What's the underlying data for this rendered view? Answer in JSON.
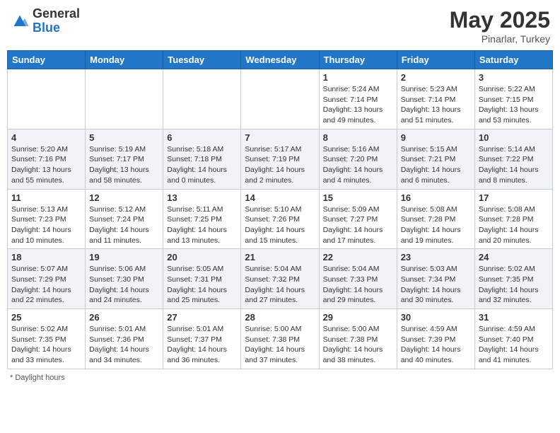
{
  "header": {
    "logo_general": "General",
    "logo_blue": "Blue",
    "month": "May 2025",
    "location": "Pinarlar, Turkey"
  },
  "days_of_week": [
    "Sunday",
    "Monday",
    "Tuesday",
    "Wednesday",
    "Thursday",
    "Friday",
    "Saturday"
  ],
  "footer": {
    "daylight_label": "Daylight hours"
  },
  "weeks": [
    {
      "days": [
        {
          "num": "",
          "info": ""
        },
        {
          "num": "",
          "info": ""
        },
        {
          "num": "",
          "info": ""
        },
        {
          "num": "",
          "info": ""
        },
        {
          "num": "1",
          "info": "Sunrise: 5:24 AM\nSunset: 7:14 PM\nDaylight: 13 hours\nand 49 minutes."
        },
        {
          "num": "2",
          "info": "Sunrise: 5:23 AM\nSunset: 7:14 PM\nDaylight: 13 hours\nand 51 minutes."
        },
        {
          "num": "3",
          "info": "Sunrise: 5:22 AM\nSunset: 7:15 PM\nDaylight: 13 hours\nand 53 minutes."
        }
      ]
    },
    {
      "days": [
        {
          "num": "4",
          "info": "Sunrise: 5:20 AM\nSunset: 7:16 PM\nDaylight: 13 hours\nand 55 minutes."
        },
        {
          "num": "5",
          "info": "Sunrise: 5:19 AM\nSunset: 7:17 PM\nDaylight: 13 hours\nand 58 minutes."
        },
        {
          "num": "6",
          "info": "Sunrise: 5:18 AM\nSunset: 7:18 PM\nDaylight: 14 hours\nand 0 minutes."
        },
        {
          "num": "7",
          "info": "Sunrise: 5:17 AM\nSunset: 7:19 PM\nDaylight: 14 hours\nand 2 minutes."
        },
        {
          "num": "8",
          "info": "Sunrise: 5:16 AM\nSunset: 7:20 PM\nDaylight: 14 hours\nand 4 minutes."
        },
        {
          "num": "9",
          "info": "Sunrise: 5:15 AM\nSunset: 7:21 PM\nDaylight: 14 hours\nand 6 minutes."
        },
        {
          "num": "10",
          "info": "Sunrise: 5:14 AM\nSunset: 7:22 PM\nDaylight: 14 hours\nand 8 minutes."
        }
      ]
    },
    {
      "days": [
        {
          "num": "11",
          "info": "Sunrise: 5:13 AM\nSunset: 7:23 PM\nDaylight: 14 hours\nand 10 minutes."
        },
        {
          "num": "12",
          "info": "Sunrise: 5:12 AM\nSunset: 7:24 PM\nDaylight: 14 hours\nand 11 minutes."
        },
        {
          "num": "13",
          "info": "Sunrise: 5:11 AM\nSunset: 7:25 PM\nDaylight: 14 hours\nand 13 minutes."
        },
        {
          "num": "14",
          "info": "Sunrise: 5:10 AM\nSunset: 7:26 PM\nDaylight: 14 hours\nand 15 minutes."
        },
        {
          "num": "15",
          "info": "Sunrise: 5:09 AM\nSunset: 7:27 PM\nDaylight: 14 hours\nand 17 minutes."
        },
        {
          "num": "16",
          "info": "Sunrise: 5:08 AM\nSunset: 7:28 PM\nDaylight: 14 hours\nand 19 minutes."
        },
        {
          "num": "17",
          "info": "Sunrise: 5:08 AM\nSunset: 7:28 PM\nDaylight: 14 hours\nand 20 minutes."
        }
      ]
    },
    {
      "days": [
        {
          "num": "18",
          "info": "Sunrise: 5:07 AM\nSunset: 7:29 PM\nDaylight: 14 hours\nand 22 minutes."
        },
        {
          "num": "19",
          "info": "Sunrise: 5:06 AM\nSunset: 7:30 PM\nDaylight: 14 hours\nand 24 minutes."
        },
        {
          "num": "20",
          "info": "Sunrise: 5:05 AM\nSunset: 7:31 PM\nDaylight: 14 hours\nand 25 minutes."
        },
        {
          "num": "21",
          "info": "Sunrise: 5:04 AM\nSunset: 7:32 PM\nDaylight: 14 hours\nand 27 minutes."
        },
        {
          "num": "22",
          "info": "Sunrise: 5:04 AM\nSunset: 7:33 PM\nDaylight: 14 hours\nand 29 minutes."
        },
        {
          "num": "23",
          "info": "Sunrise: 5:03 AM\nSunset: 7:34 PM\nDaylight: 14 hours\nand 30 minutes."
        },
        {
          "num": "24",
          "info": "Sunrise: 5:02 AM\nSunset: 7:35 PM\nDaylight: 14 hours\nand 32 minutes."
        }
      ]
    },
    {
      "days": [
        {
          "num": "25",
          "info": "Sunrise: 5:02 AM\nSunset: 7:35 PM\nDaylight: 14 hours\nand 33 minutes."
        },
        {
          "num": "26",
          "info": "Sunrise: 5:01 AM\nSunset: 7:36 PM\nDaylight: 14 hours\nand 34 minutes."
        },
        {
          "num": "27",
          "info": "Sunrise: 5:01 AM\nSunset: 7:37 PM\nDaylight: 14 hours\nand 36 minutes."
        },
        {
          "num": "28",
          "info": "Sunrise: 5:00 AM\nSunset: 7:38 PM\nDaylight: 14 hours\nand 37 minutes."
        },
        {
          "num": "29",
          "info": "Sunrise: 5:00 AM\nSunset: 7:38 PM\nDaylight: 14 hours\nand 38 minutes."
        },
        {
          "num": "30",
          "info": "Sunrise: 4:59 AM\nSunset: 7:39 PM\nDaylight: 14 hours\nand 40 minutes."
        },
        {
          "num": "31",
          "info": "Sunrise: 4:59 AM\nSunset: 7:40 PM\nDaylight: 14 hours\nand 41 minutes."
        }
      ]
    }
  ]
}
